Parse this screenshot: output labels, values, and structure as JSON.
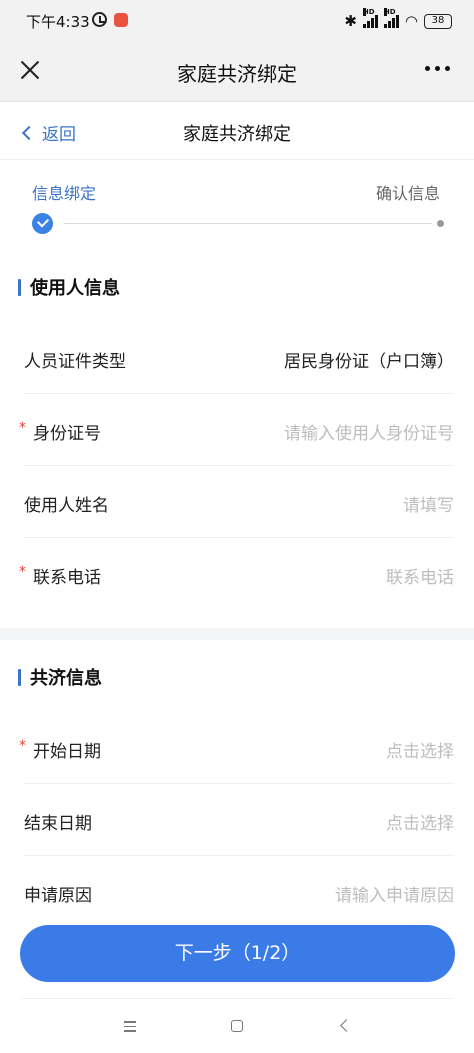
{
  "status_bar": {
    "time": "下午4:33",
    "battery": "38",
    "signal_badge": "HD"
  },
  "title_bar": {
    "title": "家庭共济绑定"
  },
  "page_nav": {
    "back_label": "返回",
    "title": "家庭共济绑定"
  },
  "steps": {
    "step1_label": "信息绑定",
    "step2_label": "确认信息"
  },
  "user_section": {
    "heading": "使用人信息",
    "rows": [
      {
        "label": "人员证件类型",
        "value": "居民身份证（户口簿）",
        "required": false
      },
      {
        "label": "身份证号",
        "placeholder": "请输入使用人身份证号",
        "required": true
      },
      {
        "label": "使用人姓名",
        "placeholder": "请填写",
        "required": false
      },
      {
        "label": "联系电话",
        "placeholder": "联系电话",
        "required": true
      }
    ]
  },
  "share_section": {
    "heading": "共济信息",
    "rows": [
      {
        "label": "开始日期",
        "placeholder": "点击选择",
        "required": true
      },
      {
        "label": "结束日期",
        "placeholder": "点击选择",
        "required": false
      },
      {
        "label": "申请原因",
        "placeholder": "请输入申请原因",
        "required": false
      }
    ]
  },
  "next_button": {
    "label": "下一步（1/2）"
  },
  "colors": {
    "accent": "#3b7be8",
    "link": "#3a73c9",
    "required": "#e2442f",
    "placeholder": "#bdbdbd"
  },
  "icons": [
    "alarm-icon",
    "bluetooth-icon",
    "signal-icon",
    "wifi-icon",
    "battery-icon",
    "close-icon",
    "more-icon",
    "chevron-left-icon",
    "check-icon",
    "menu-icon",
    "home-icon",
    "back-icon"
  ]
}
